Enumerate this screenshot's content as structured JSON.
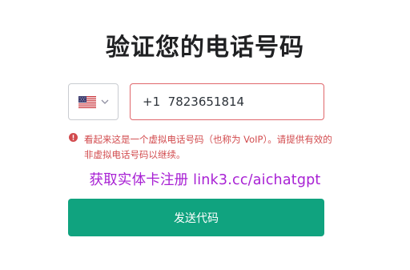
{
  "page": {
    "title": "验证您的电话号码"
  },
  "country": {
    "selected": "United States",
    "icon": "us-flag-icon"
  },
  "phone": {
    "value": "+1  7823651814",
    "border_color": "#e0676c"
  },
  "error": {
    "icon": "error-circle-icon",
    "message": "看起来这是一个虚拟电话号码（也称为 VoIP）。请提供有效的非虚拟电话号码以继续。",
    "color": "#d24b4e"
  },
  "promo": {
    "text": "获取实体卡注册  link3.cc/aichatgpt",
    "color": "#a821d4"
  },
  "actions": {
    "send_label": "发送代码",
    "color": "#10a37f"
  }
}
